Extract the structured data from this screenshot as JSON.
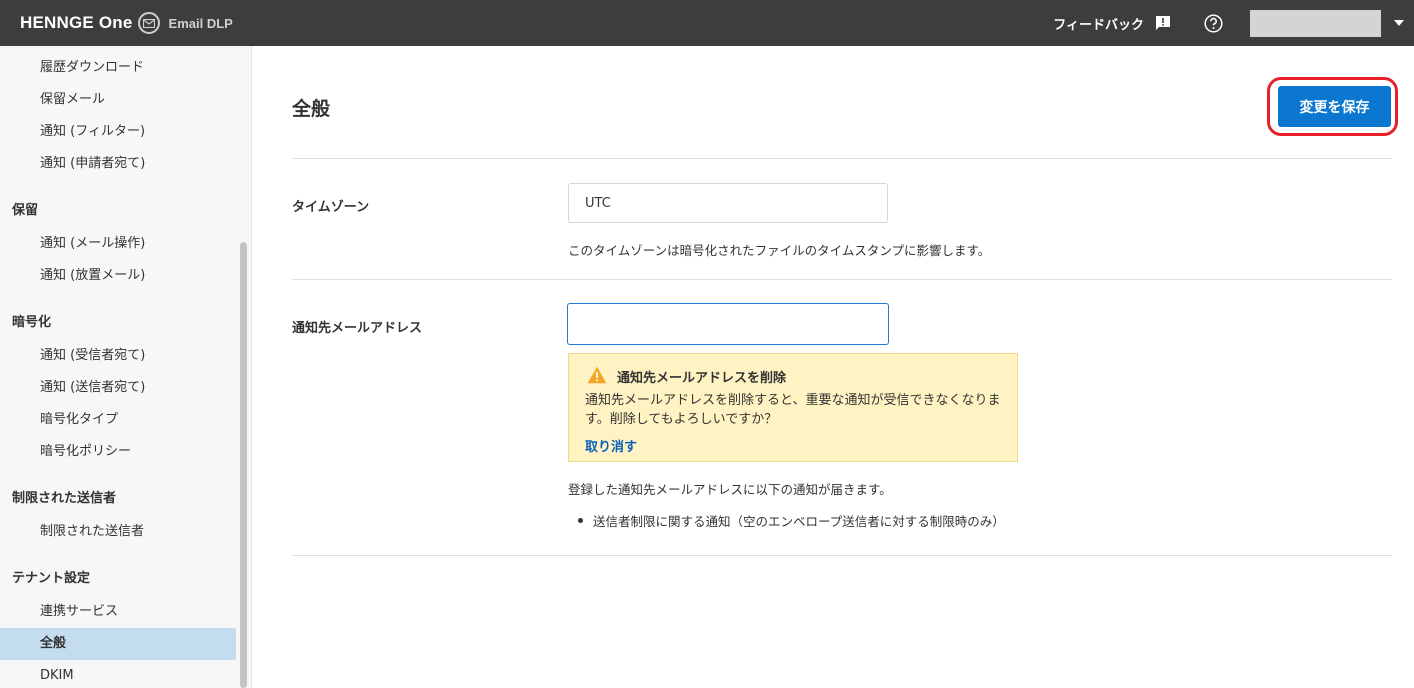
{
  "header": {
    "brand_name": "HENNGE One",
    "product_name": "Email DLP",
    "feedback_label": "フィードバック",
    "icons": {
      "brand": "mail-icon",
      "feedback": "feedback-icon",
      "help": "help-icon",
      "menu": "caret-down-icon"
    }
  },
  "sidebar": {
    "groups": [
      {
        "header": "",
        "items": [
          "履歴ダウンロード",
          "保留メール",
          "通知 (フィルター)",
          "通知 (申請者宛て)"
        ]
      },
      {
        "header": "保留",
        "items": [
          "通知 (メール操作)",
          "通知 (放置メール)"
        ]
      },
      {
        "header": "暗号化",
        "items": [
          "通知 (受信者宛て)",
          "通知 (送信者宛て)",
          "暗号化タイプ",
          "暗号化ポリシー"
        ]
      },
      {
        "header": "制限された送信者",
        "items": [
          "制限された送信者"
        ]
      },
      {
        "header": "テナント設定",
        "items": [
          "連携サービス",
          "全般",
          "DKIM"
        ]
      }
    ],
    "active_item": "全般"
  },
  "main": {
    "title": "全般",
    "save_label": "変更を保存",
    "timezone": {
      "label": "タイムゾーン",
      "value": "UTC",
      "help": "このタイムゾーンは暗号化されたファイルのタイムスタンプに影響します。"
    },
    "notify_email": {
      "label": "通知先メールアドレス",
      "value": "",
      "warning_title": "通知先メールアドレスを削除",
      "warning_body": "通知先メールアドレスを削除すると、重要な通知が受信できなくなります。削除してもよろしいですか？",
      "undo_label": "取り消す",
      "help": "登録した通知先メールアドレスに以下の通知が届きます。",
      "bullets": [
        "送信者制限に関する通知（空のエンベロープ送信者に対する制限時のみ）"
      ]
    }
  },
  "colors": {
    "topbar": "#3d3d3d",
    "primary": "#0b77d1",
    "highlight_ring": "#e8202a",
    "warning_bg": "#fff3c4",
    "active_nav": "#c3dcee",
    "link": "#0a63b8"
  }
}
